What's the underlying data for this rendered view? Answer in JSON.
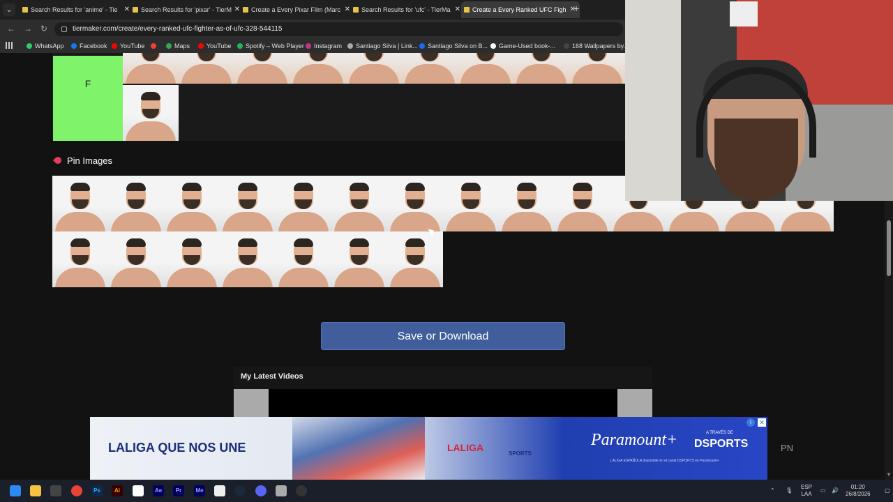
{
  "browser": {
    "tabs": [
      {
        "title": "Search Results for 'anime' - Tie"
      },
      {
        "title": "Search Results for 'pixar' - TierM"
      },
      {
        "title": "Create a Every Pixar Film (Marc"
      },
      {
        "title": "Search Results for 'ufc' - TierMa"
      },
      {
        "title": "Create a Every Ranked UFC Figh",
        "active": true
      }
    ],
    "url": "tiermaker.com/create/every-ranked-ufc-fighter-as-of-ufc-328-544115",
    "bookmarks": [
      {
        "label": "WhatsApp",
        "color": "#2ecc71"
      },
      {
        "label": "Facebook",
        "color": "#1877f2"
      },
      {
        "label": "YouTube",
        "color": "#ff0000"
      },
      {
        "label": "",
        "color": "#ea4335"
      },
      {
        "label": "Maps",
        "color": "#34a853"
      },
      {
        "label": "YouTube",
        "color": "#ff0000"
      },
      {
        "label": "Spotify – Web Player",
        "color": "#1db954"
      },
      {
        "label": "Instagram",
        "color": "#c13584"
      },
      {
        "label": "Santiago Silva | Link...",
        "color": "#aaaaaa"
      },
      {
        "label": "Santiago Silva on B...",
        "color": "#1769ff"
      },
      {
        "label": "Game-Used book-...",
        "color": "#ffffff"
      },
      {
        "label": "168 Wallpapers by...",
        "color": "#444444"
      }
    ]
  },
  "tier": {
    "label": "F",
    "color": "#7ff46a"
  },
  "pin_section": {
    "title": "Pin Images"
  },
  "save_button": "Save or Download",
  "videos": {
    "title": "My Latest Videos"
  },
  "ad": {
    "left_text": "LALIGA QUE NOS UNE",
    "laliga": "LALIGA",
    "dsports_small": "SPORTS",
    "a_traves": "A TRAVÉS DE",
    "paramount": "Paramount+",
    "dsports": "DSPORTS",
    "fine_print": "LALIGA ESPAÑOLA disponible en el canal DSPORTS en Paramount+"
  },
  "side_text": "PN",
  "taskbar": {
    "lang": "ESP",
    "region": "LAA",
    "time": "01:20",
    "date": "26/8/2026"
  }
}
